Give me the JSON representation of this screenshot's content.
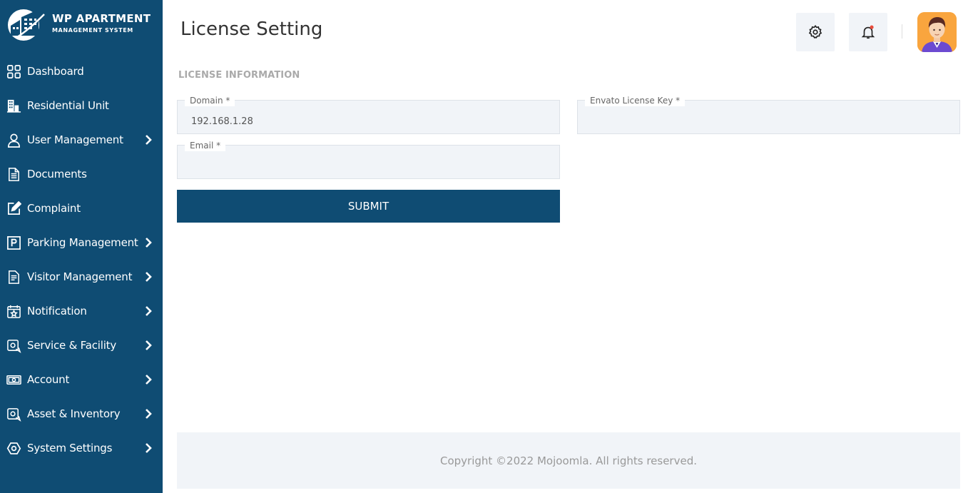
{
  "brand": {
    "title": "WP APARTMENT",
    "subtitle": "MANAGEMENT SYSTEM"
  },
  "sidebar": {
    "items": [
      {
        "label": "Dashboard",
        "icon": "grid-icon",
        "has_submenu": false
      },
      {
        "label": "Residential Unit",
        "icon": "building-icon",
        "has_submenu": false
      },
      {
        "label": "User Management",
        "icon": "user-icon",
        "has_submenu": true
      },
      {
        "label": "Documents",
        "icon": "document-icon",
        "has_submenu": false
      },
      {
        "label": "Complaint",
        "icon": "edit-icon",
        "has_submenu": false
      },
      {
        "label": "Parking Management",
        "icon": "parking-icon",
        "has_submenu": true
      },
      {
        "label": "Visitor Management",
        "icon": "clipboard-icon",
        "has_submenu": true
      },
      {
        "label": "Notification",
        "icon": "calendar-star-icon",
        "has_submenu": true
      },
      {
        "label": "Service & Facility",
        "icon": "service-icon",
        "has_submenu": true
      },
      {
        "label": "Account",
        "icon": "money-icon",
        "has_submenu": true
      },
      {
        "label": "Asset & Inventory",
        "icon": "asset-icon",
        "has_submenu": true
      },
      {
        "label": "System Settings",
        "icon": "settings-hex-icon",
        "has_submenu": true
      }
    ]
  },
  "header": {
    "title": "License Setting",
    "settings_icon": "gear-icon",
    "notification_icon": "bell-icon"
  },
  "form": {
    "section_title": "LICENSE INFORMATION",
    "domain_label": "Domain *",
    "domain_value": "192.168.1.28",
    "license_label": "Envato License Key *",
    "license_value": "",
    "email_label": "Email *",
    "email_value": "",
    "submit_label": "SUBMIT"
  },
  "footer": {
    "copyright": "Copyright ©2022 Mojoomla. All rights reserved."
  },
  "colors": {
    "sidebar_bg": "#0f4c73",
    "field_bg": "#f1f4f8",
    "notification_dot": "#e74c3c",
    "avatar_bg": "#f9a53e"
  }
}
